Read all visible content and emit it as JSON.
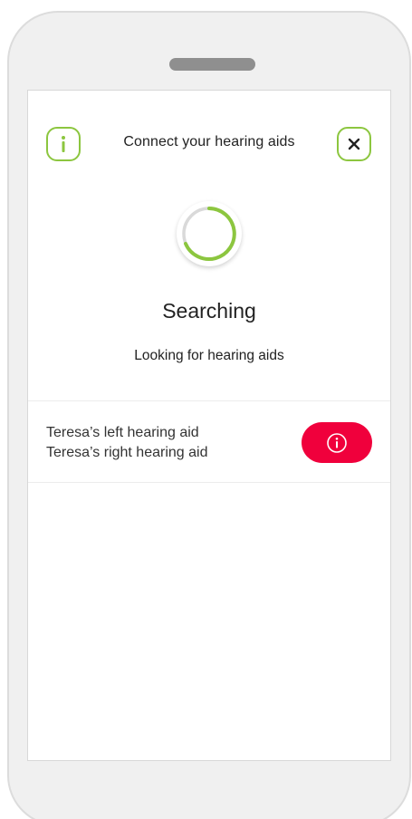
{
  "header": {
    "title": "Connect your hearing aids",
    "info_icon": "info-icon",
    "close_icon": "close-icon"
  },
  "status": {
    "title": "Searching",
    "subtitle": "Looking for hearing aids",
    "spinner_icon": "loading-spinner-icon"
  },
  "devices": [
    {
      "name": "Teresa’s left hearing aid"
    },
    {
      "name": "Teresa’s right hearing aid"
    }
  ],
  "device_info_icon": "info-icon",
  "colors": {
    "accent": "#8cc63f",
    "alert": "#f0003c",
    "text": "#222222",
    "frame": "#f0f0f0"
  }
}
